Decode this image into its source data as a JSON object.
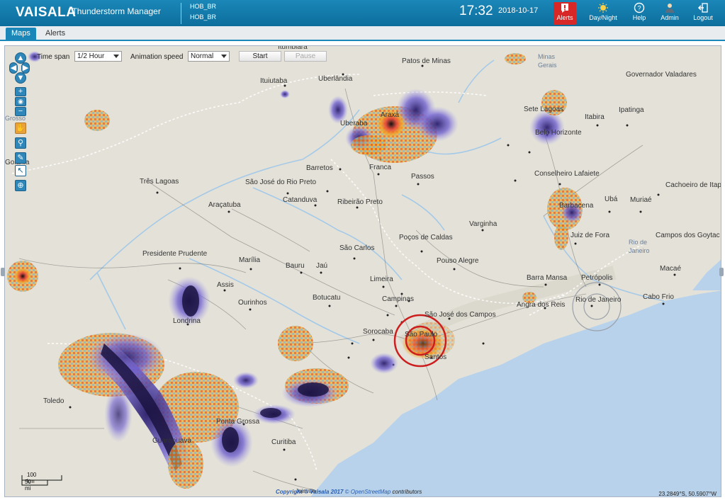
{
  "header": {
    "brand": "VAISALA",
    "product": "/ Thunderstorm Manager",
    "stations": [
      "HOB_BR",
      "HOB_BR"
    ],
    "time": "17:32",
    "date": "2018-10-17",
    "buttons": [
      {
        "label": "Alerts",
        "icon": "alert-icon",
        "active": true
      },
      {
        "label": "Day/Night",
        "icon": "day-night-icon"
      },
      {
        "label": "Help",
        "icon": "help-icon"
      },
      {
        "label": "Admin",
        "icon": "admin-icon"
      },
      {
        "label": "Logout",
        "icon": "logout-icon"
      }
    ]
  },
  "tabs": [
    {
      "label": "Maps",
      "active": true
    },
    {
      "label": "Alerts",
      "active": false
    }
  ],
  "toolbar": {
    "time_span_label": "Time span",
    "time_span_value": "1/2 Hour",
    "animation_speed_label": "Animation speed",
    "animation_speed_value": "Normal",
    "start_label": "Start",
    "pause_label": "Pause"
  },
  "map": {
    "cities": [
      "Patos de Minas",
      "Minas",
      "Gerais",
      "Governador Valadares",
      "Ituiutaba",
      "Uberlândia",
      "Uberaba",
      "Araxá",
      "Sete Lagoas",
      "Itabira",
      "Ipatinga",
      "Belo Horizonte",
      "Franca",
      "Barretos",
      "Passos",
      "Conselheiro Lafaiete",
      "Cachoeiro de Itap",
      "Três Lagoas",
      "São José do Rio Preto",
      "Catanduva",
      "Ribeirão Preto",
      "Araçatuba",
      "Ubá",
      "Muriaé",
      "Barbacena",
      "Varginha",
      "Juiz de Fora",
      "Campos dos Goytac",
      "Poços de Caldas",
      "São Carlos",
      "Presidente Prudente",
      "Marília",
      "Bauru",
      "Jaú",
      "Pouso Alegre",
      "Rio de",
      "Janeiro",
      "Macaé",
      "Barra Mansa",
      "Petrópolis",
      "Assis",
      "Limeira",
      "Ourinhos",
      "Botucatu",
      "Campinas",
      "Cabo Frio",
      "Rio de Janeiro",
      "Angra dos Reis",
      "São José dos Campos",
      "Sorocaba",
      "Londrina",
      "São Paulo",
      "Santos",
      "Toledo",
      "Ponta Grossa",
      "Guarapuava",
      "Curitiba",
      "Joinville",
      "Grosso",
      "Goiânia",
      "Ituiutaba",
      "Uberlândia"
    ],
    "scale_km": "100 km",
    "scale_mi": "50 mi",
    "copyright_prefix": "Copyright ©",
    "copyright_brand": "Vaisala 2017",
    "osm_link": "© OpenStreetMap",
    "copyright_suffix": "contributors",
    "coordinates": "23.2849°S, 50.5907°W",
    "top_clip": "Itumbiara",
    "left_clip_1": "Grosso",
    "left_clip_2": "Goiânia"
  },
  "colors": {
    "header": "#1a87b8",
    "alert": "#d82727",
    "storm_dark": "#1a1340",
    "storm_purple": "#7a6bd0",
    "storm_orange": "#f5a623",
    "storm_red": "#e8473a",
    "storm_blue": "#6fb4e6",
    "ring": "#cc1e1e"
  }
}
